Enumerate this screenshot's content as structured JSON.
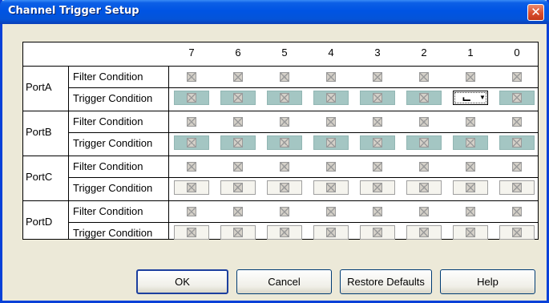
{
  "window": {
    "title": "Channel Trigger Setup",
    "close_glyph": "✕"
  },
  "columns": [
    "7",
    "6",
    "5",
    "4",
    "3",
    "2",
    "1",
    "0"
  ],
  "ports": [
    {
      "name": "PortA",
      "filter_label": "Filter Condition",
      "trigger_label": "Trigger Condition",
      "trigger_style": "teal"
    },
    {
      "name": "PortB",
      "filter_label": "Filter Condition",
      "trigger_label": "Trigger Condition",
      "trigger_style": "teal"
    },
    {
      "name": "PortC",
      "filter_label": "Filter Condition",
      "trigger_label": "Trigger Condition",
      "trigger_style": "plain"
    },
    {
      "name": "PortD",
      "filter_label": "Filter Condition",
      "trigger_label": "Trigger Condition",
      "trigger_style": "plain"
    }
  ],
  "selected_trigger": {
    "port": "PortA",
    "channel": "1",
    "value": "falling-edge-icon",
    "glyph": "⌙"
  },
  "colors": {
    "teal_cell": "#a4c6c3",
    "titlebar": "#0054e3"
  },
  "buttons": {
    "ok": "OK",
    "cancel": "Cancel",
    "restore": "Restore Defaults",
    "help": "Help"
  }
}
